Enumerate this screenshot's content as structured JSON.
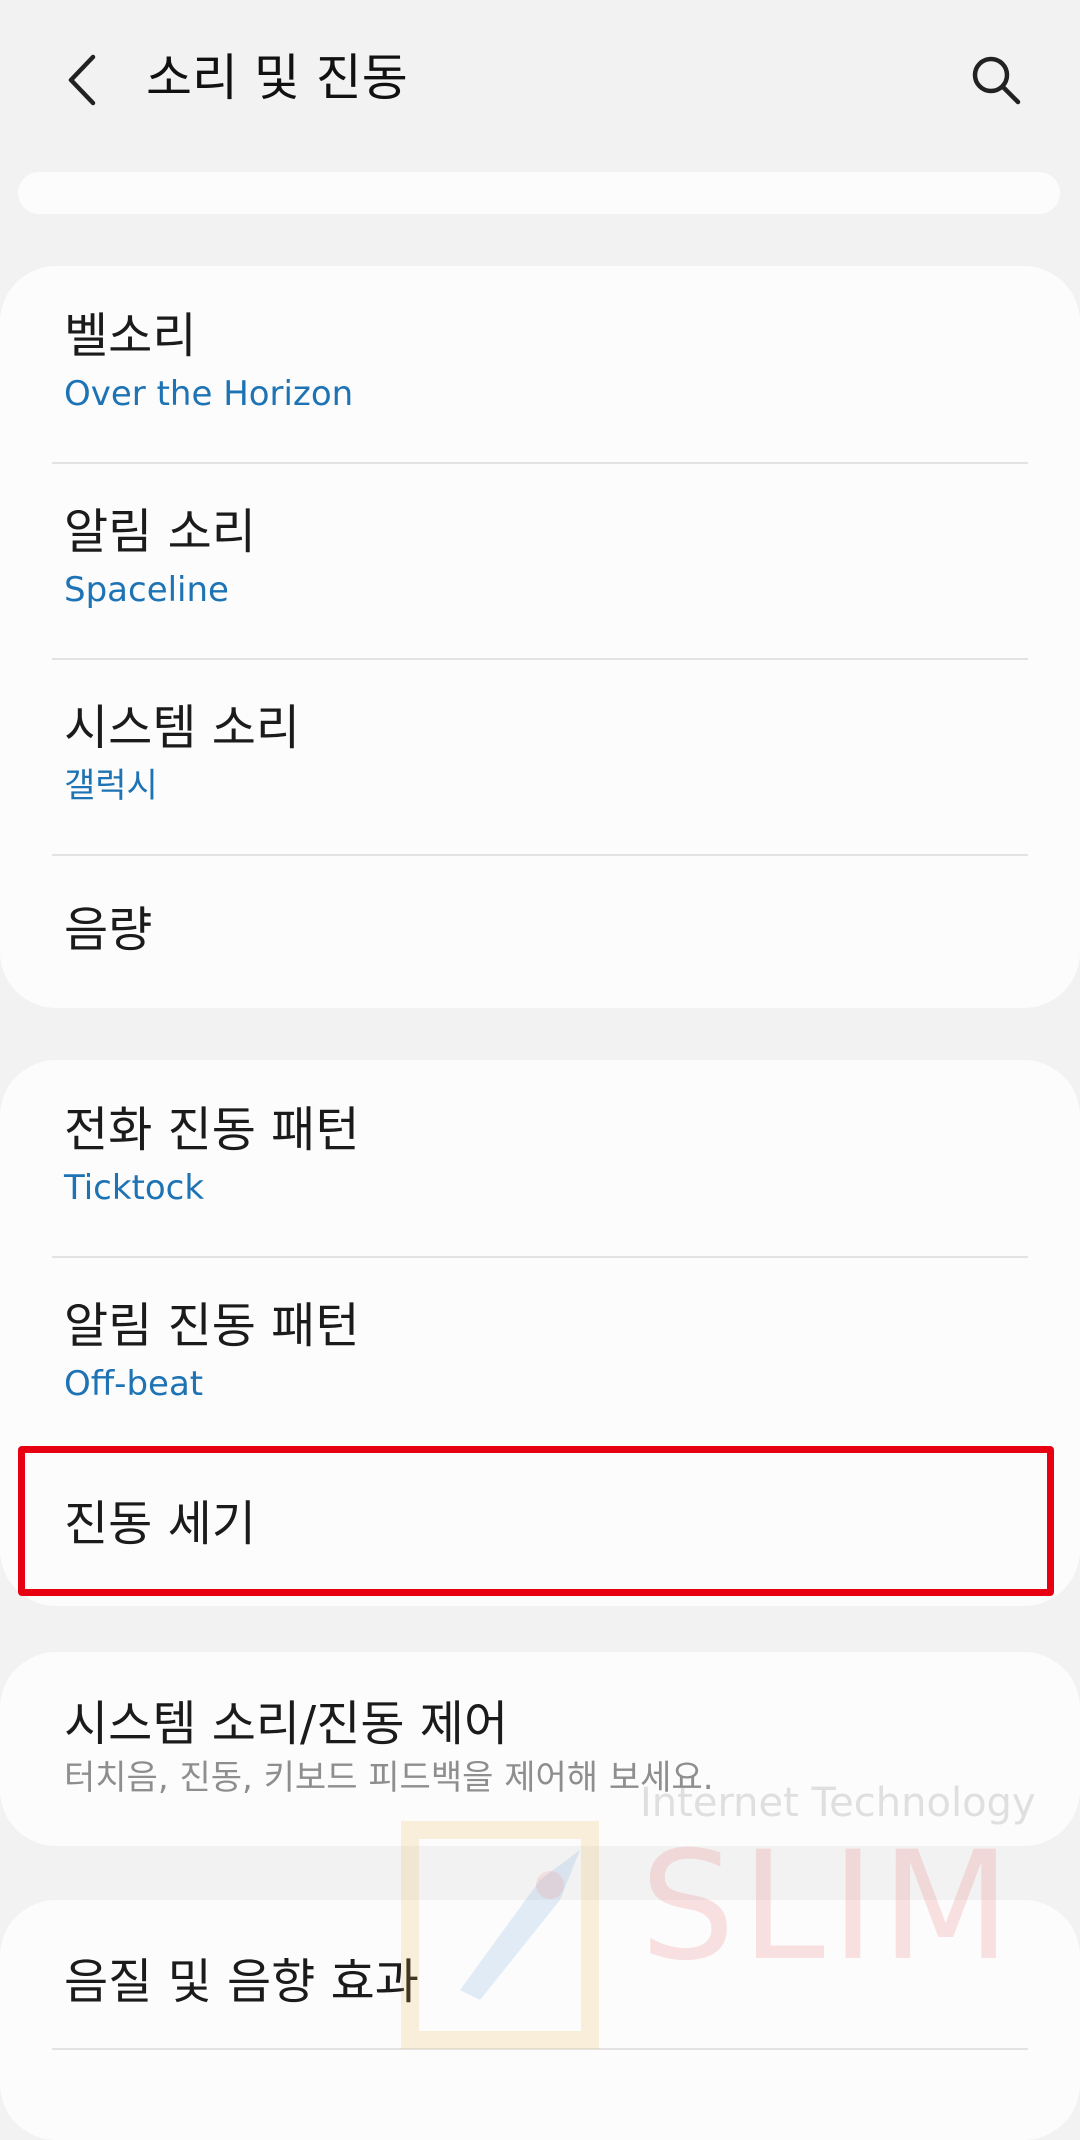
{
  "header": {
    "title": "소리 및 진동"
  },
  "groups": [
    {
      "items": [
        {
          "title": "벨소리",
          "subtitle": "Over the Horizon"
        },
        {
          "title": "알림 소리",
          "subtitle": "Spaceline"
        },
        {
          "title": "시스템 소리",
          "subtitle": "갤럭시"
        },
        {
          "title": "음량"
        }
      ]
    },
    {
      "items": [
        {
          "title": "전화 진동 패턴",
          "subtitle": "Ticktock"
        },
        {
          "title": "알림 진동 패턴",
          "subtitle": "Off-beat"
        },
        {
          "title": "진동 세기"
        }
      ]
    },
    {
      "items": [
        {
          "title": "시스템 소리/진동 제어",
          "subtitle": "터치음, 진동, 키보드 피드백을 제어해 보세요."
        }
      ]
    },
    {
      "items": [
        {
          "title": "음질 및 음향 효과"
        }
      ]
    }
  ],
  "watermark": {
    "line1": "Internet Technology",
    "line2": "SLIM"
  },
  "colors": {
    "background": "#f2f2f2",
    "card": "#fcfcfc",
    "subtitle_blue": "#1d73b4",
    "subtitle_gray": "#8e8e8e",
    "highlight_red": "#e60012"
  },
  "icons": {
    "back": "chevron-left-icon",
    "search": "search-icon"
  }
}
